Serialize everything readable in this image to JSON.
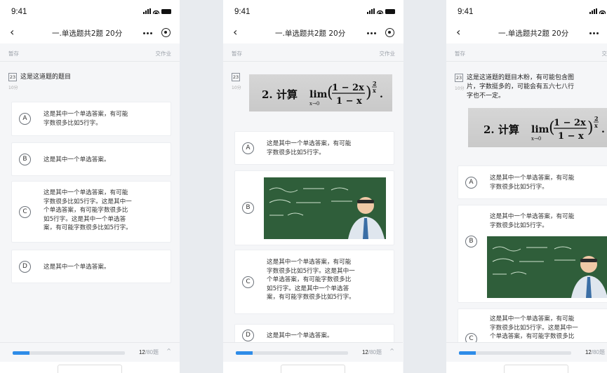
{
  "status": {
    "time": "9:41"
  },
  "nav": {
    "back_glyph": "‹",
    "title": "一.单选题共2题 20分",
    "more_icon": "more-dots-icon",
    "target_icon": "target-icon"
  },
  "toolbar": {
    "save": "暂存",
    "submit": "交作业"
  },
  "screens": [
    {
      "question": {
        "number": "23",
        "text": "这是这道题的题目",
        "score": "10分"
      },
      "options": [
        {
          "letter": "A",
          "lines": [
            "这是其中一个单选答案，有可能",
            "字数很多比如5行字。"
          ]
        },
        {
          "letter": "B",
          "lines": [
            "这是其中一个单选答案。"
          ]
        },
        {
          "letter": "C",
          "lines": [
            "这是其中一个单选答案，有可能",
            "字数很多比如5行字。这是其中一",
            "个单选答案，有可能字数很多比",
            "如5行字。这是其中一个单选答",
            "案，有可能字数很多比如5行字。"
          ]
        },
        {
          "letter": "D",
          "lines": [
            "这是其中一个单选答案。"
          ]
        }
      ]
    },
    {
      "question": {
        "number": "23",
        "score": "10分"
      },
      "formula": {
        "prefix": "2. 计算",
        "lim": "lim",
        "sub": "x→0",
        "num": "1 − 2x",
        "den": "1 − x",
        "exp_num": "2",
        "exp_den": "x"
      },
      "options": [
        {
          "letter": "A",
          "lines": [
            "这是其中一个单选答案，有可能",
            "字数很多比如5行字。"
          ]
        },
        {
          "letter": "B",
          "lines": []
        },
        {
          "letter": "C",
          "lines": [
            "这是其中一个单选答案，有可能",
            "字数很多比如5行字。这是其中一",
            "个单选答案，有可能字数很多比",
            "如5行字。这是其中一个单选答",
            "案，有可能字数很多比如5行字。"
          ]
        },
        {
          "letter": "D",
          "lines": [
            "这是其中一个单选答案。"
          ]
        }
      ]
    },
    {
      "question": {
        "number": "23",
        "score": "10分",
        "lines": [
          "这是这道题的题目木粉，有可能包含图",
          "片，字数挺多的，可能会有五六七八行",
          "字也不一定。"
        ]
      },
      "formula": {
        "prefix": "2. 计算",
        "lim": "lim",
        "sub": "x→0",
        "num": "1 − 2x",
        "den": "1 − x",
        "exp_num": "2",
        "exp_den": "x"
      },
      "options": [
        {
          "letter": "A",
          "lines": [
            "这是其中一个单选答案，有可能",
            "字数很多比如5行字。"
          ]
        },
        {
          "letter": "B",
          "lines": [
            "这是其中一个单选答案，有可能",
            "字数很多比如5行字。"
          ]
        },
        {
          "letter": "C",
          "lines": [
            "这是其中一个单选答案，有可能",
            "字数很多比如5行字。这是其中一",
            "个单选答案，有可能字数很多比"
          ]
        }
      ]
    }
  ],
  "progress": {
    "current": "12",
    "total": "/80题",
    "fraction": 0.15,
    "chevron": "^"
  },
  "colors": {
    "accent": "#2e8ce8",
    "board": "#2f5e3a"
  }
}
